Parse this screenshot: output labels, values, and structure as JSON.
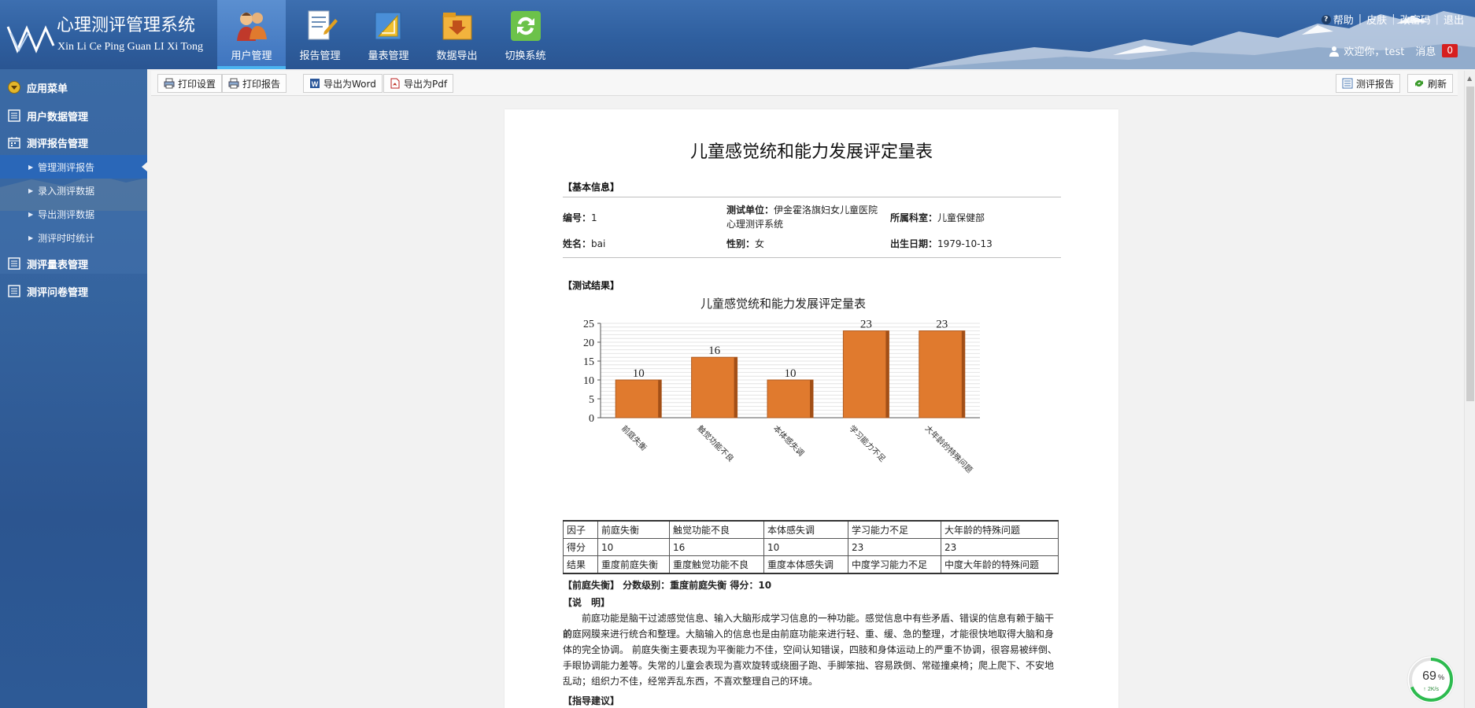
{
  "app": {
    "title": "心理测评管理系统",
    "subtitle": "Xin Li Ce Ping Guan LI Xi Tong"
  },
  "nav": [
    {
      "label": "用户管理",
      "icon": "users-icon",
      "active": true
    },
    {
      "label": "报告管理",
      "icon": "report-icon",
      "active": false
    },
    {
      "label": "量表管理",
      "icon": "ruler-icon",
      "active": false
    },
    {
      "label": "数据导出",
      "icon": "export-folder-icon",
      "active": false
    },
    {
      "label": "切换系统",
      "icon": "switch-icon",
      "active": false
    }
  ],
  "top_links": {
    "help": "帮助",
    "skin": "皮肤",
    "change_password": "改密码",
    "logout": "退出"
  },
  "user": {
    "welcome": "欢迎你，test",
    "messages_label": "消息",
    "messages_count": "0"
  },
  "sidebar": {
    "menu_title": "应用菜单",
    "items": [
      {
        "label": "用户数据管理"
      },
      {
        "label": "测评报告管理",
        "children": [
          {
            "label": "管理测评报告",
            "active": true
          },
          {
            "label": "录入测评数据"
          },
          {
            "label": "导出测评数据"
          },
          {
            "label": "测评时时统计"
          }
        ]
      },
      {
        "label": "测评量表管理"
      },
      {
        "label": "测评问卷管理"
      }
    ]
  },
  "toolbar": {
    "print_settings": "打印设置",
    "print_report": "打印报告",
    "export_word": "导出为Word",
    "export_pdf": "导出为Pdf",
    "eval_report": "测评报告",
    "refresh": "刷新"
  },
  "report": {
    "title": "儿童感觉统和能力发展评定量表",
    "basic_info_label": "【基本信息】",
    "fields": {
      "id_label": "编号：",
      "id_value": "1",
      "unit_label": "测试单位：",
      "unit_value_line1": "伊金霍洛旗妇女儿童医院",
      "unit_value_line2": "心理测评系统",
      "dept_label": "所属科室：",
      "dept_value": "儿童保健部",
      "name_label": "姓名：",
      "name_value": "bai",
      "gender_label": "性别：",
      "gender_value": "女",
      "birth_label": "出生日期：",
      "birth_value": "1979-10-13"
    },
    "results_label": "【测试结果】",
    "table": {
      "row_headers": [
        "因子",
        "得分",
        "结果"
      ],
      "factors": [
        "前庭失衡",
        "触觉功能不良",
        "本体感失调",
        "学习能力不足",
        "大年龄的特殊问题"
      ],
      "scores": [
        "10",
        "16",
        "10",
        "23",
        "23"
      ],
      "results": [
        "重度前庭失衡",
        "重度触觉功能不良",
        "重度本体感失调",
        "中度学习能力不足",
        "中度大年龄的特殊问题"
      ]
    },
    "factor_summary": "【前庭失衡】 分数级别：重度前庭失衡 得分：10",
    "explain_label": "【说　明】",
    "explain_lines": [
      "　　前庭功能是脑干过滤感觉信息、输入大脑形成学习信息的一种功能。感觉信息中有些矛盾、错误的信息有赖于脑干的",
      "前庭网膜来进行统合和整理。大脑输入的信息也是由前庭功能来进行轻、重、缓、急的整理，才能很快地取得大脑和身",
      "体的完全协调。 前庭失衡主要表现为平衡能力不佳，空间认知错误，四肢和身体运动上的严重不协调，很容易被绊倒、",
      "手眼协调能力差等。失常的儿童会表现为喜欢旋转或绕圈子跑、手脚笨拙、容易跌倒、常碰撞桌椅；爬上爬下、不安地",
      "乱动；组织力不佳，经常弄乱东西，不喜欢整理自己的环境。"
    ],
    "guidance_label": "【指导建议】"
  },
  "chart_data": {
    "type": "bar",
    "title": "儿童感觉统和能力发展评定量表",
    "categories": [
      "前庭失衡",
      "触觉功能不良",
      "本体感失调",
      "学习能力不足",
      "大年龄的特殊问题"
    ],
    "values": [
      10,
      16,
      10,
      23,
      23
    ],
    "ylim": [
      0,
      25
    ],
    "yticks": [
      0,
      5,
      10,
      15,
      20,
      25
    ],
    "grid": true,
    "bar_color": "#e07a2e",
    "xlabel": "",
    "ylabel": ""
  },
  "status_widget": {
    "percent": "69",
    "percent_sign": "%",
    "speed": "2K/s"
  },
  "colors": {
    "header": "#2f5f9f",
    "sidebar": "#35649f",
    "active_nav": "#4bb3f0",
    "badge": "#d61f1f",
    "bar": "#e07a2e"
  }
}
